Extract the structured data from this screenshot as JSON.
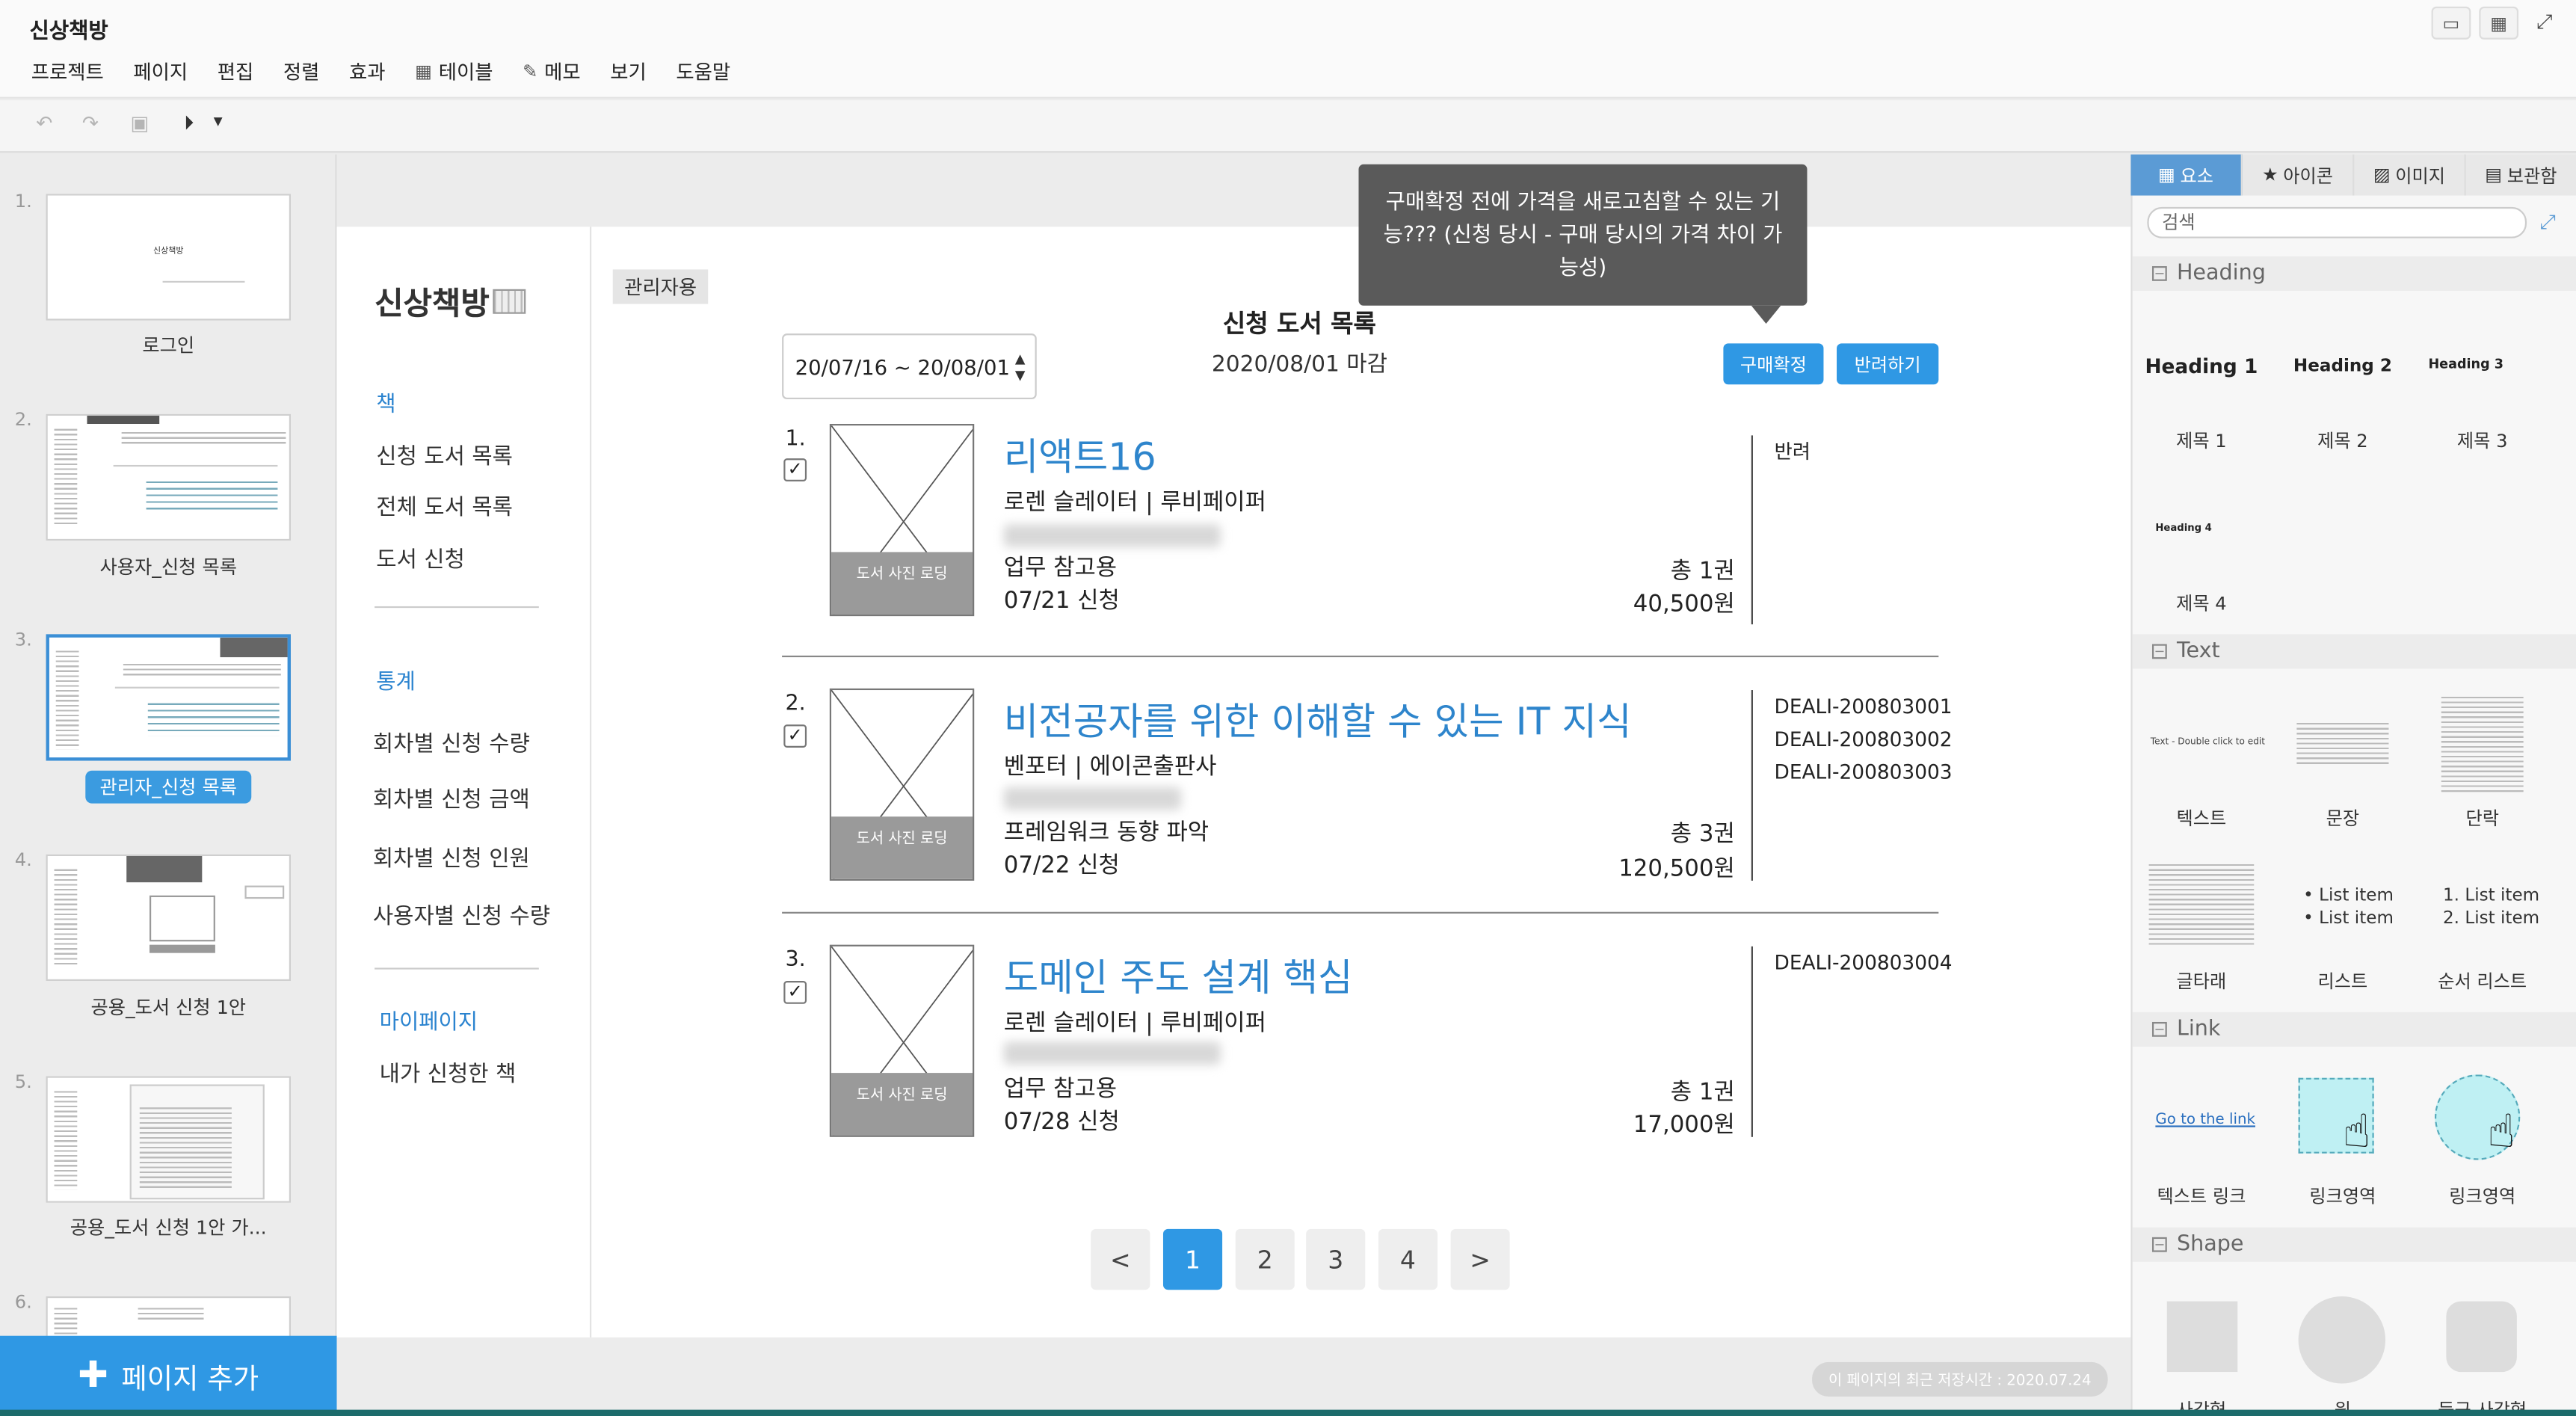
{
  "app": {
    "title": "신상책방"
  },
  "menu": [
    "프로젝트",
    "페이지",
    "편집",
    "정렬",
    "효과",
    "테이블",
    "메모",
    "보기",
    "도움말"
  ],
  "pages": [
    {
      "num": "1.",
      "label": "로그인",
      "thumb_title": "신상책방"
    },
    {
      "num": "2.",
      "label": "사용자_신청 목록"
    },
    {
      "num": "3.",
      "label": "관리자_신청 목록",
      "selected": true
    },
    {
      "num": "4.",
      "label": "공용_도서 신청 1안"
    },
    {
      "num": "5.",
      "label": "공용_도서 신청 1안 가..."
    },
    {
      "num": "6.",
      "label": ""
    }
  ],
  "add_page_label": "페이지 추가",
  "save_status": "이 페이지의 최근 저장시간 : 2020.07.24",
  "sidebar": {
    "brand": "신상책방",
    "section_book": "책",
    "book_items": [
      "신청 도서 목록",
      "전체 도서 목록",
      "도서 신청"
    ],
    "section_stats": "통계",
    "stats_items": [
      "회차별 신청 수량",
      "회차별 신청 금액",
      "회차별 신청 인원",
      "사용자별 신청 수량"
    ],
    "section_my": "마이페이지",
    "my_items": [
      "내가 신청한 책"
    ]
  },
  "main": {
    "admin_badge": "관리자용",
    "title": "신청 도서 목록",
    "deadline": "2020/08/01 마감",
    "date_range": "20/07/16 ~ 20/08/01",
    "confirm_button": "구매확정",
    "reject_button": "반려하기",
    "tooltip": "구매확정 전에 가격을 새로고침할 수 있는 기능??? (신청 당시 - 구매 당시의 가격 차이 가능성)",
    "thumb_caption": "도서 사진 로딩",
    "books": [
      {
        "num": "1.",
        "title": "리액트16",
        "publisher": "로렌 슬레이터 | 루비페이퍼",
        "purpose": "업무 참고용",
        "date": "07/21 신청",
        "qty": "총 1권",
        "price": "40,500원",
        "status": [
          "반려"
        ]
      },
      {
        "num": "2.",
        "title": "비전공자를 위한 이해할 수 있는 IT 지식",
        "publisher": "벤포터 | 에이콘출판사",
        "purpose": "프레임워크 동향 파악",
        "date": "07/22 신청",
        "qty": "총 3권",
        "price": "120,500원",
        "status": [
          "DEALI-200803001",
          "DEALI-200803002",
          "DEALI-200803003"
        ]
      },
      {
        "num": "3.",
        "title": "도메인 주도 설계 핵심",
        "publisher": "로렌 슬레이터 | 루비페이퍼",
        "purpose": "업무 참고용",
        "date": "07/28 신청",
        "qty": "총 1권",
        "price": "17,000원",
        "status": [
          "DEALI-200803004"
        ]
      }
    ],
    "pagination": {
      "prev": "<",
      "pages": [
        "1",
        "2",
        "3",
        "4"
      ],
      "current": "1",
      "next": ">"
    }
  },
  "right_panel": {
    "tabs": [
      "요소",
      "아이콘",
      "이미지",
      "보관함"
    ],
    "active_tab": "요소",
    "search_placeholder": "검색",
    "heading_section": "Heading",
    "headings": [
      {
        "preview": "Heading 1",
        "label": "제목 1"
      },
      {
        "preview": "Heading 2",
        "label": "제목 2"
      },
      {
        "preview": "Heading 3",
        "label": "제목 3"
      },
      {
        "preview": "Heading 4",
        "label": "제목 4"
      }
    ],
    "text_section": "Text",
    "text_preview": "Text - Double click to edit",
    "text_items": [
      "텍스트",
      "문장",
      "단락",
      "글타래",
      "리스트",
      "순서 리스트"
    ],
    "list_item": "List item",
    "link_section": "Link",
    "link_preview": "Go to the link",
    "link_items": [
      "텍스트 링크",
      "링크영역",
      "링크영역"
    ],
    "shape_section": "Shape",
    "shape_items": [
      "사각형",
      "원",
      "둥근 사각형"
    ]
  }
}
